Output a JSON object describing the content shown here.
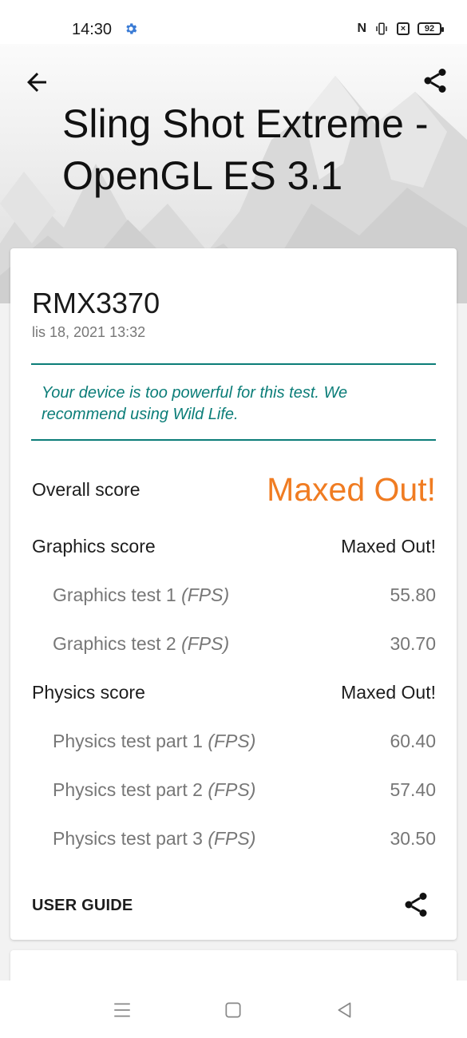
{
  "status_bar": {
    "time": "14:30",
    "icons": [
      "settings-gear-icon",
      "nfc-icon",
      "vibrate-icon",
      "no-sim-icon",
      "battery-icon"
    ],
    "nfc_glyph": "N",
    "sim_glyph": "×",
    "battery_level": "92",
    "accent_color": "#3a7bd5"
  },
  "header": {
    "title": "Sling Shot Extreme - OpenGL ES 3.1",
    "back_icon": "arrow-left-icon",
    "share_icon": "share-icon"
  },
  "result": {
    "device": "RMX3370",
    "date": "lis 18, 2021 13:32",
    "note": "Your device is too powerful for this test. We recommend using Wild Life.",
    "overall": {
      "label": "Overall score",
      "value": "Maxed Out!"
    },
    "graphics": {
      "label": "Graphics score",
      "value": "Maxed Out!",
      "tests": [
        {
          "label": "Graphics test 1",
          "unit": "(FPS)",
          "value": "55.80"
        },
        {
          "label": "Graphics test 2",
          "unit": "(FPS)",
          "value": "30.70"
        }
      ]
    },
    "physics": {
      "label": "Physics score",
      "value": "Maxed Out!",
      "tests": [
        {
          "label": "Physics test part 1",
          "unit": "(FPS)",
          "value": "60.40"
        },
        {
          "label": "Physics test part 2",
          "unit": "(FPS)",
          "value": "57.40"
        },
        {
          "label": "Physics test part 3",
          "unit": "(FPS)",
          "value": "30.50"
        }
      ]
    },
    "user_guide": "USER GUIDE",
    "colors": {
      "accent_teal": "#0b7d78",
      "maxed_orange": "#f07c22"
    }
  },
  "nav_bar": {
    "icons": [
      "menu-icon",
      "home-icon",
      "back-triangle-icon"
    ]
  }
}
